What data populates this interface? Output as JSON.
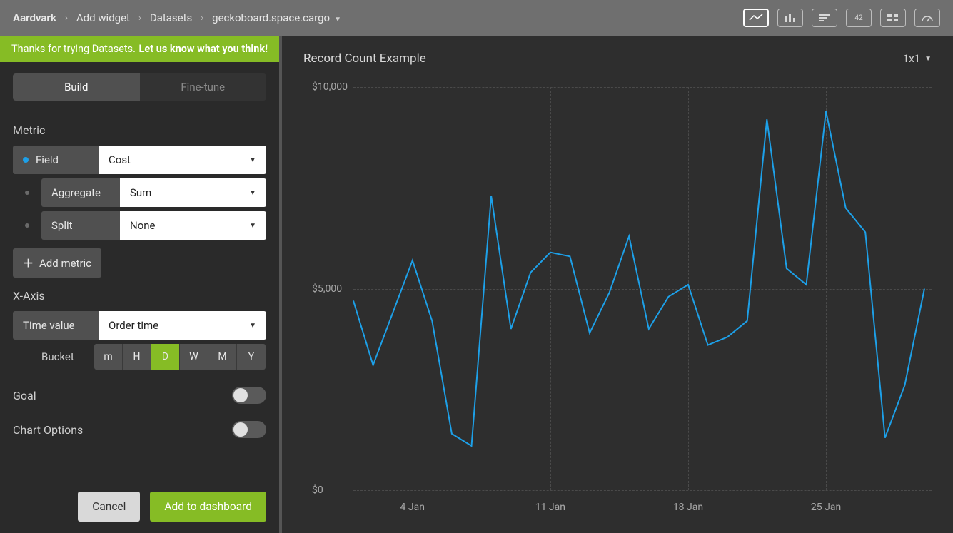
{
  "breadcrumb": {
    "root": "Aardvark",
    "step1": "Add widget",
    "step2": "Datasets",
    "current": "geckoboard.space.cargo"
  },
  "banner": {
    "text": "Thanks for trying Datasets.",
    "bold": "Let us know what you think!"
  },
  "tabs": {
    "build": "Build",
    "finetune": "Fine-tune"
  },
  "metric": {
    "section": "Metric",
    "field_label": "Field",
    "field_value": "Cost",
    "aggregate_label": "Aggregate",
    "aggregate_value": "Sum",
    "split_label": "Split",
    "split_value": "None",
    "add_metric": "Add metric"
  },
  "xaxis": {
    "section": "X-Axis",
    "time_label": "Time value",
    "time_value": "Order time",
    "bucket_label": "Bucket",
    "buckets": {
      "m": "m",
      "h": "H",
      "d": "D",
      "w": "W",
      "mo": "M",
      "y": "Y"
    }
  },
  "goal": {
    "label": "Goal"
  },
  "chart_options": {
    "label": "Chart Options"
  },
  "footer": {
    "cancel": "Cancel",
    "add": "Add to dashboard"
  },
  "preview": {
    "title": "Record Count Example",
    "size": "1x1"
  },
  "chart_data": {
    "type": "line",
    "title": "Record Count Example",
    "ylabel": "",
    "xlabel": "",
    "ylim": [
      0,
      10000
    ],
    "yticks_fmt": [
      "$0",
      "$5,000",
      "$10,000"
    ],
    "yticks": [
      0,
      5000,
      10000
    ],
    "xticks": [
      "4 Jan",
      "11 Jan",
      "18 Jan",
      "25 Jan"
    ],
    "x": [
      "1 Jan",
      "2 Jan",
      "3 Jan",
      "4 Jan",
      "5 Jan",
      "6 Jan",
      "7 Jan",
      "8 Jan",
      "9 Jan",
      "10 Jan",
      "11 Jan",
      "12 Jan",
      "13 Jan",
      "14 Jan",
      "15 Jan",
      "16 Jan",
      "17 Jan",
      "18 Jan",
      "19 Jan",
      "20 Jan",
      "21 Jan",
      "22 Jan",
      "23 Jan",
      "24 Jan",
      "25 Jan",
      "26 Jan",
      "27 Jan",
      "28 Jan",
      "29 Jan",
      "30 Jan"
    ],
    "values": [
      4700,
      3100,
      4400,
      5700,
      4200,
      1400,
      1100,
      7300,
      4000,
      5400,
      5900,
      5800,
      3900,
      4900,
      6300,
      4000,
      4800,
      5100,
      3600,
      3800,
      4200,
      9200,
      5500,
      5100,
      9400,
      7000,
      6400,
      1300,
      2600,
      5000
    ],
    "color": "#1da0e8"
  }
}
